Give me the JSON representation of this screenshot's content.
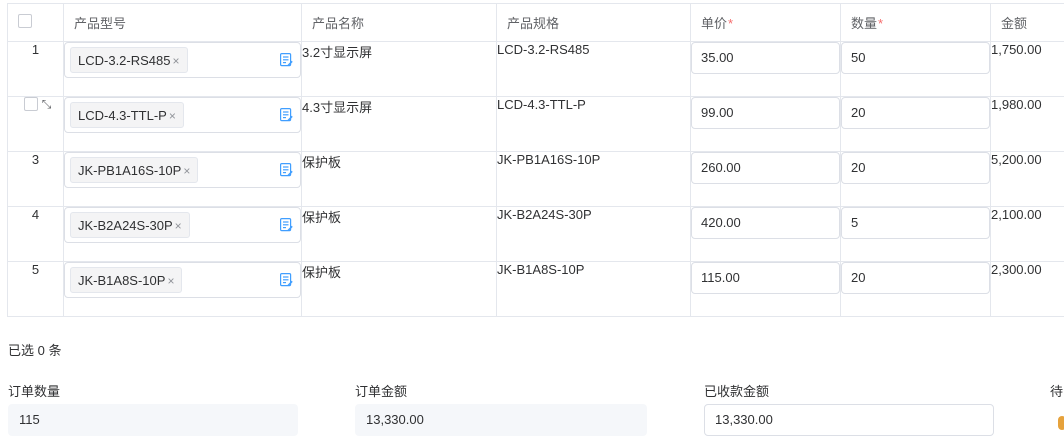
{
  "table": {
    "headers": {
      "model": "产品型号",
      "name": "产品名称",
      "spec": "产品规格",
      "price": "单价",
      "qty": "数量",
      "amount": "金额",
      "required_mark": "*"
    },
    "rows": [
      {
        "index": "1",
        "model_tag": "LCD-3.2-RS485",
        "name": "3.2寸显示屏",
        "spec": "LCD-3.2-RS485",
        "price": "35.00",
        "qty": "50",
        "amount": "1,750.00"
      },
      {
        "index": "",
        "model_tag": "LCD-4.3-TTL-P",
        "name": "4.3寸显示屏",
        "spec": "LCD-4.3-TTL-P",
        "price": "99.00",
        "qty": "20",
        "amount": "1,980.00"
      },
      {
        "index": "3",
        "model_tag": "JK-PB1A16S-10P",
        "name": "保护板",
        "spec": "JK-PB1A16S-10P",
        "price": "260.00",
        "qty": "20",
        "amount": "5,200.00"
      },
      {
        "index": "4",
        "model_tag": "JK-B2A24S-30P",
        "name": "保护板",
        "spec": "JK-B2A24S-30P",
        "price": "420.00",
        "qty": "5",
        "amount": "2,100.00"
      },
      {
        "index": "5",
        "model_tag": "JK-B1A8S-10P",
        "name": "保护板",
        "spec": "JK-B1A8S-10P",
        "price": "115.00",
        "qty": "20",
        "amount": "2,300.00"
      }
    ],
    "tag_close": "×"
  },
  "selection": {
    "text": "已选 0 条"
  },
  "summary": {
    "order_qty_label": "订单数量",
    "order_qty_value": "115",
    "order_amount_label": "订单金额",
    "order_amount_value": "13,330.00",
    "received_label": "已收款金额",
    "received_value": "13,330.00",
    "pending_label": "待"
  },
  "icons": {
    "picker": "list-edit-icon",
    "expand": "expand-arrows-icon"
  },
  "colors": {
    "required": "#f56c6c",
    "border": "#e4e7ed",
    "readonly_bg": "#f5f7fa",
    "accent_icon": "#409eff",
    "warning": "#e6a23c"
  }
}
